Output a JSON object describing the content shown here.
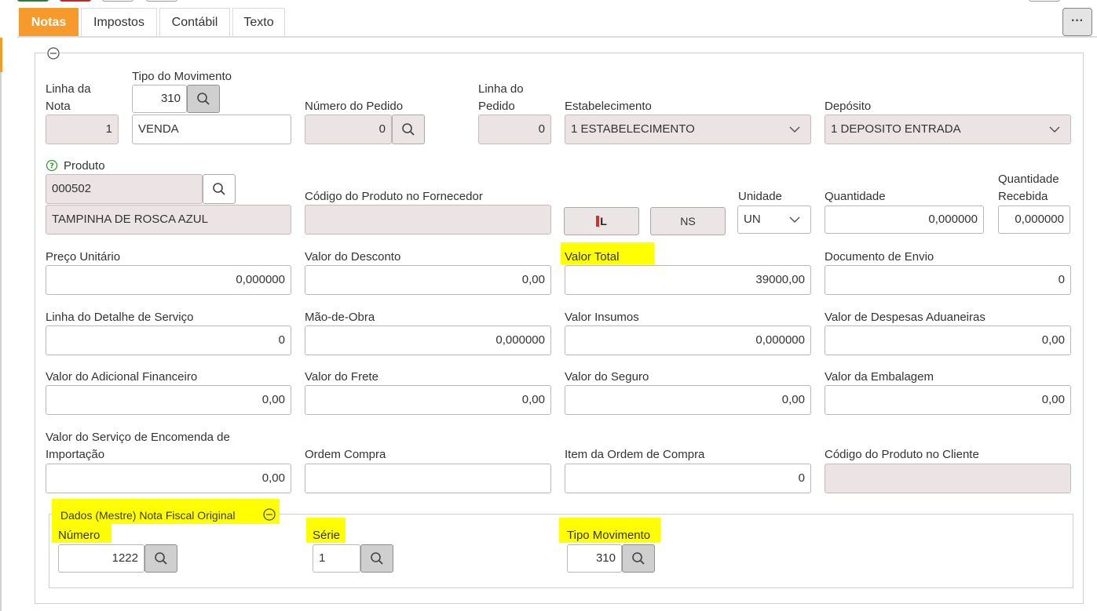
{
  "tabs": [
    "Notas",
    "Impostos",
    "Contábil",
    "Texto"
  ],
  "more_button": "···",
  "fields": {
    "linha_nota": {
      "label": "Linha da Nota",
      "value": "1"
    },
    "tipo_movimento": {
      "label": "Tipo do Movimento",
      "code": "310",
      "description": "VENDA"
    },
    "numero_pedido": {
      "label": "Número do Pedido",
      "value": "0"
    },
    "linha_pedido": {
      "label": "Linha do Pedido",
      "value": "0"
    },
    "estabelecimento": {
      "label": "Estabelecimento",
      "value": "1 ESTABELECIMENTO"
    },
    "deposito": {
      "label": "Depósito",
      "value": "1 DEPOSITO ENTRADA"
    },
    "produto": {
      "label": "Produto",
      "code": "000502",
      "description": "TAMPINHA DE ROSCA AZUL"
    },
    "codigo_produto_fornecedor": {
      "label": "Código do Produto no Fornecedor",
      "value": ""
    },
    "lote_button": "L",
    "ns_button": "NS",
    "unidade": {
      "label": "Unidade",
      "value": "UN"
    },
    "quantidade": {
      "label": "Quantidade",
      "value": "0,000000"
    },
    "quantidade_recebida": {
      "label": "Quantidade Recebida",
      "value": "0,000000"
    },
    "preco_unitario": {
      "label": "Preço Unitário",
      "value": "0,000000"
    },
    "valor_desconto": {
      "label": "Valor do Desconto",
      "value": "0,00"
    },
    "valor_total": {
      "label": "Valor Total",
      "value": "39000,00"
    },
    "documento_envio": {
      "label": "Documento de Envio",
      "value": "0"
    },
    "linha_detalhe_servico": {
      "label": "Linha do Detalhe de Serviço",
      "value": "0"
    },
    "mao_de_obra": {
      "label": "Mão-de-Obra",
      "value": "0,000000"
    },
    "valor_insumos": {
      "label": "Valor Insumos",
      "value": "0,000000"
    },
    "valor_despesas_aduaneiras": {
      "label": "Valor de Despesas Aduaneiras",
      "value": "0,00"
    },
    "valor_adicional_financeiro": {
      "label": "Valor do Adicional Financeiro",
      "value": "0,00"
    },
    "valor_frete": {
      "label": "Valor do Frete",
      "value": "0,00"
    },
    "valor_seguro": {
      "label": "Valor do Seguro",
      "value": "0,00"
    },
    "valor_embalagem": {
      "label": "Valor da Embalagem",
      "value": "0,00"
    },
    "valor_servico_encomenda": {
      "label": "Valor do Serviço de Encomenda de Importação",
      "value": "0,00"
    },
    "ordem_compra": {
      "label": "Ordem Compra",
      "value": ""
    },
    "item_ordem_compra": {
      "label": "Item da Ordem de Compra",
      "value": "0"
    },
    "codigo_produto_cliente": {
      "label": "Código do Produto no Cliente",
      "value": ""
    }
  },
  "nota_original": {
    "title": "Dados (Mestre) Nota Fiscal Original",
    "numero": {
      "label": "Número",
      "value": "1222"
    },
    "serie": {
      "label": "Série",
      "value": "1"
    },
    "tipo_movimento": {
      "label": "Tipo Movimento",
      "value": "310"
    }
  },
  "colors": {
    "tab_active": "#f59a2b",
    "highlight": "#ffff00",
    "readonly_bg": "#ece4e4"
  }
}
